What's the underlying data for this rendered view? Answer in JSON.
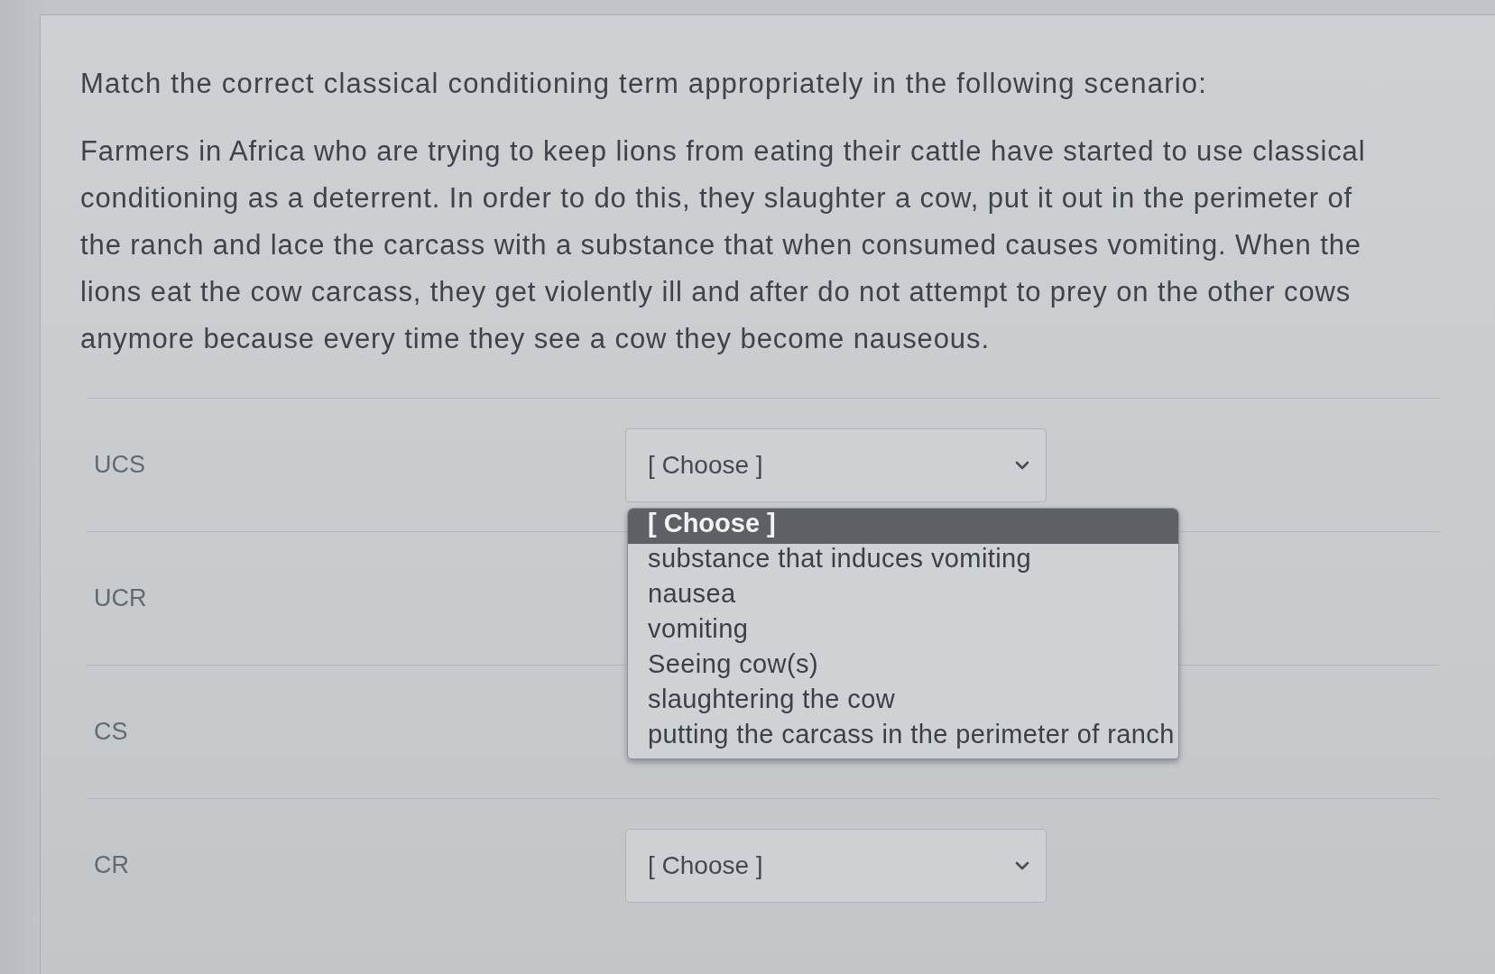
{
  "question": {
    "title": "Match the correct classical conditioning term appropriately in the following scenario:",
    "scenario": "Farmers in Africa who are trying to keep lions from eating their cattle have started to use classical conditioning as a deterrent. In order to do this, they slaughter a cow, put it out in the perimeter of the ranch and lace the carcass with a substance that when consumed causes vomiting. When the lions eat the cow carcass, they get violently ill and after do not attempt to prey on the other cows anymore because every time they see a cow they become nauseous."
  },
  "matches": [
    {
      "term": "UCS",
      "select": {
        "value": "[ Choose ]",
        "expanded": true,
        "options": [
          {
            "label": "[ Choose ]",
            "selected": true
          },
          {
            "label": "substance that induces vomiting",
            "selected": false
          },
          {
            "label": "nausea",
            "selected": false
          },
          {
            "label": "vomiting",
            "selected": false
          },
          {
            "label": "Seeing cow(s)",
            "selected": false
          },
          {
            "label": "slaughtering the cow",
            "selected": false
          },
          {
            "label": "putting the carcass in the perimeter of ranch",
            "selected": false
          }
        ]
      }
    },
    {
      "term": "UCR"
    },
    {
      "term": "CS"
    },
    {
      "term": "CR",
      "select": {
        "value": "[ Choose ]",
        "expanded": false
      }
    }
  ]
}
